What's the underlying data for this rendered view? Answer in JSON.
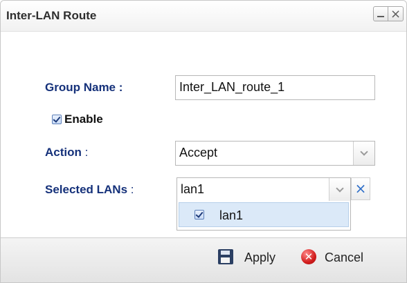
{
  "window": {
    "title": "Inter-LAN Route",
    "minimize_glyph": "",
    "close_glyph": "×"
  },
  "form": {
    "group_name": {
      "label": "Group Name :",
      "value": "Inter_LAN_route_1"
    },
    "enable": {
      "label": "Enable",
      "checked": true
    },
    "action": {
      "label": "Action",
      "colon": ":",
      "value": "Accept"
    },
    "selected_lans": {
      "label": "Selected LANs",
      "colon": ":",
      "value": "lan1",
      "clear_glyph": "×",
      "options": [
        {
          "label": "lan1",
          "checked": true
        }
      ]
    }
  },
  "footer": {
    "apply_label": "Apply",
    "cancel_label": "Cancel"
  },
  "colors": {
    "label_blue": "#15317a",
    "clear_blue": "#2f6fc9",
    "cancel_red": "#d21d1d"
  }
}
